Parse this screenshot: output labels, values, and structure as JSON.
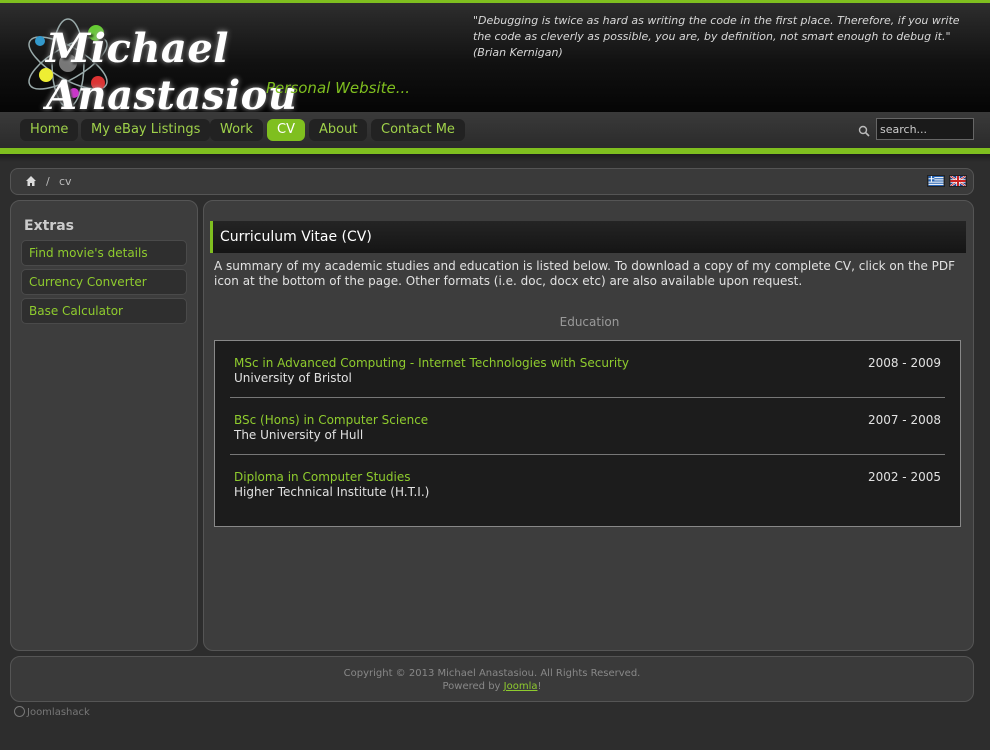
{
  "header": {
    "site_name": "Michael Anastasiou",
    "tagline": "Personal Website...",
    "quote": "\"Debugging is twice as hard as writing the code in the first place. Therefore, if you write the code as cleverly as possible, you are, by definition, not smart enough to debug it.\" (Brian Kernigan)"
  },
  "nav": {
    "items": [
      {
        "label": "Home"
      },
      {
        "label": "My eBay Listings"
      },
      {
        "label": "Work"
      },
      {
        "label": "CV"
      },
      {
        "label": "About"
      },
      {
        "label": "Contact Me"
      }
    ],
    "search_value": "search..."
  },
  "breadcrumb": {
    "separator": "/",
    "current": "cv"
  },
  "sidebar": {
    "title": "Extras",
    "items": [
      {
        "label": "Find movie's details"
      },
      {
        "label": "Currency Converter"
      },
      {
        "label": "Base Calculator"
      }
    ]
  },
  "main": {
    "title": "Curriculum Vitae (CV)",
    "intro": "A summary of my academic studies and education is listed below. To download a copy of my complete CV, click on the PDF icon at the bottom of the page. Other formats (i.e. doc, docx etc) are also available upon request.",
    "education_heading": "Education",
    "education": [
      {
        "degree": "MSc in Advanced Computing - Internet Technologies with Security",
        "school": "University of Bristol",
        "years": "2008 - 2009"
      },
      {
        "degree": "BSc (Hons) in Computer Science",
        "school": "The University of Hull",
        "years": "2007 - 2008"
      },
      {
        "degree": "Diploma in Computer Studies",
        "school": "Higher Technical Institute (H.T.I.)",
        "years": "2002 - 2005"
      }
    ]
  },
  "footer": {
    "copyright": "Copyright © 2013 Michael Anastasiou. All Rights Reserved.",
    "powered_prefix": "Powered by ",
    "powered_link": "Joomla",
    "powered_suffix": "!",
    "credit": "Joomlashack"
  },
  "colors": {
    "accent": "#7fbf1f",
    "link": "#8fcc2e",
    "background": "#2d2d2d"
  }
}
